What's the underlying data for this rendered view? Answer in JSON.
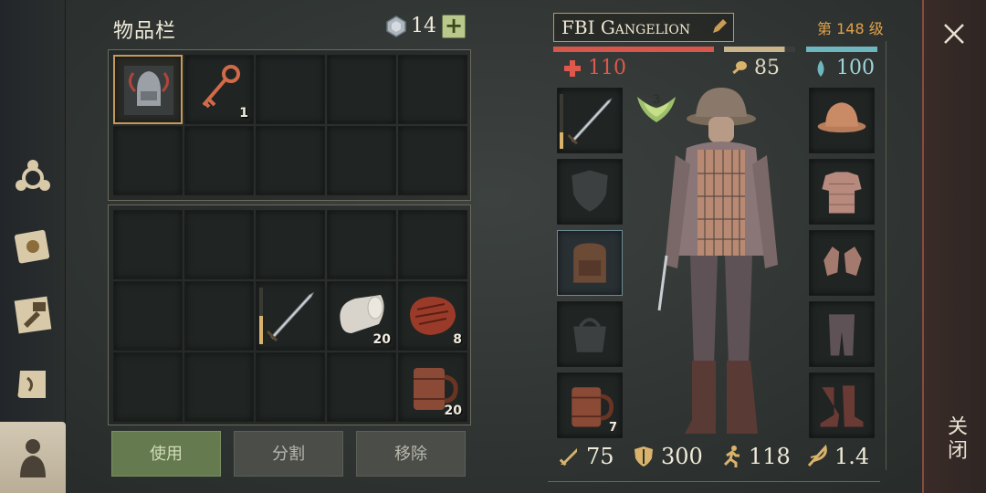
{
  "inventory": {
    "title": "物品栏",
    "currency_count": "14",
    "add_label": "+",
    "slots_top": [
      {
        "item": "helmet-icon",
        "count": ""
      },
      {
        "item": "key-icon",
        "count": "1"
      }
    ],
    "slots_bottom": [
      {
        "item": "sword-icon",
        "count": "",
        "durability": 0.5
      },
      {
        "item": "cloth-roll-icon",
        "count": "20"
      },
      {
        "item": "steak-icon",
        "count": "8"
      },
      {
        "item": "mug-icon",
        "count": "20"
      }
    ],
    "actions": {
      "use": "使用",
      "split": "分割",
      "remove": "移除"
    }
  },
  "character": {
    "name": "FBI Gangelion",
    "level": "第 148 级",
    "rank": "3",
    "health": "110",
    "food": "85",
    "water": "100",
    "bars": {
      "health": 1.0,
      "food": 0.85,
      "water": 1.0
    },
    "colors": {
      "health": "#d8574c",
      "food": "#c9b48c",
      "water": "#6fb7bf"
    },
    "equipment_left": [
      {
        "slot": "weapon",
        "item": "sword-icon",
        "count": "",
        "durability": 0.3
      },
      {
        "slot": "shield",
        "item": "shield-placeholder-icon",
        "count": ""
      },
      {
        "slot": "backpack",
        "item": "backpack-icon",
        "count": ""
      },
      {
        "slot": "bag",
        "item": "bag-placeholder-icon",
        "count": ""
      },
      {
        "slot": "quick",
        "item": "mug-icon",
        "count": "7"
      }
    ],
    "equipment_right": [
      {
        "slot": "head",
        "item": "kettle-hat-icon"
      },
      {
        "slot": "chest",
        "item": "chainmail-icon"
      },
      {
        "slot": "hands",
        "item": "gloves-icon"
      },
      {
        "slot": "legs",
        "item": "pants-icon"
      },
      {
        "slot": "feet",
        "item": "boots-icon"
      }
    ],
    "stats": {
      "attack": "75",
      "armor": "300",
      "speed": "118",
      "weight": "1.4"
    }
  },
  "close": {
    "label": "关闭"
  }
}
